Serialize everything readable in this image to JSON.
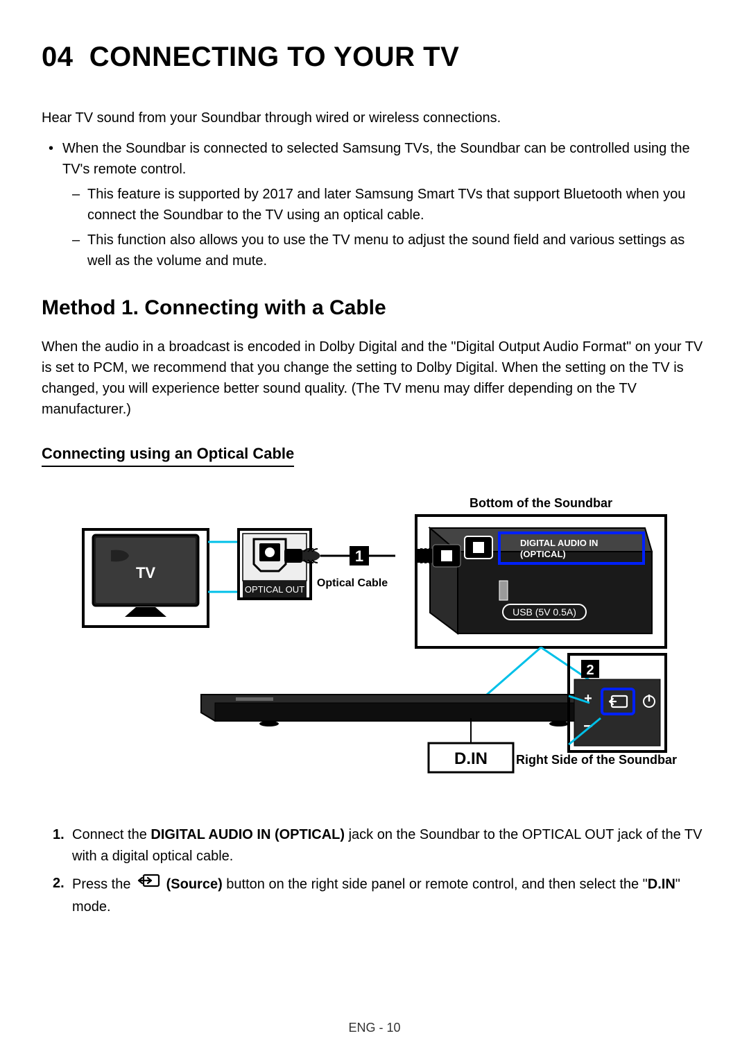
{
  "chapter": {
    "number": "04",
    "title": "CONNECTING TO YOUR TV"
  },
  "intro": "Hear TV sound from your Soundbar through wired or wireless connections.",
  "bullet_main": "When the Soundbar is connected to selected Samsung TVs, the Soundbar can be controlled using the TV's remote control.",
  "bullet_sub1": "This feature is supported by 2017 and later Samsung Smart TVs that support Bluetooth when you connect the Soundbar to the TV using an optical cable.",
  "bullet_sub2": "This function also allows you to use the TV menu to adjust the sound field and various settings as well as the volume and mute.",
  "method1": {
    "heading": "Method 1. Connecting with a Cable",
    "para": "When the audio in a broadcast is encoded in Dolby Digital and the \"Digital Output Audio Format\" on your TV is set to PCM, we recommend that you change the setting to Dolby Digital. When the setting on the TV is changed, you will experience better sound quality. (The TV menu may differ depending on the TV manufacturer.)",
    "sub_heading": "Connecting using an Optical Cable"
  },
  "diagram": {
    "label_bottom_soundbar": "Bottom of the Soundbar",
    "label_right_soundbar": "Right Side of the Soundbar",
    "tv_label": "TV",
    "optical_out": "OPTICAL OUT",
    "optical_cable": "Optical Cable",
    "digital_audio_in_1": "DIGITAL AUDIO IN",
    "digital_audio_in_2": "(OPTICAL)",
    "usb_label": "USB (5V 0.5A)",
    "display_label": "D.IN",
    "step_badge_1": "1",
    "step_badge_2": "2",
    "plus": "+",
    "minus": "–"
  },
  "steps": {
    "s1_a": "Connect the ",
    "s1_bold": "DIGITAL AUDIO IN (OPTICAL)",
    "s1_b": " jack on the Soundbar to the OPTICAL OUT jack of the TV with a digital optical cable.",
    "s2_a": "Press the ",
    "s2_source": "(Source)",
    "s2_b": " button on the right side panel or remote control, and then select the \"",
    "s2_din": "D.IN",
    "s2_c": "\" mode."
  },
  "footer": "ENG - 10"
}
